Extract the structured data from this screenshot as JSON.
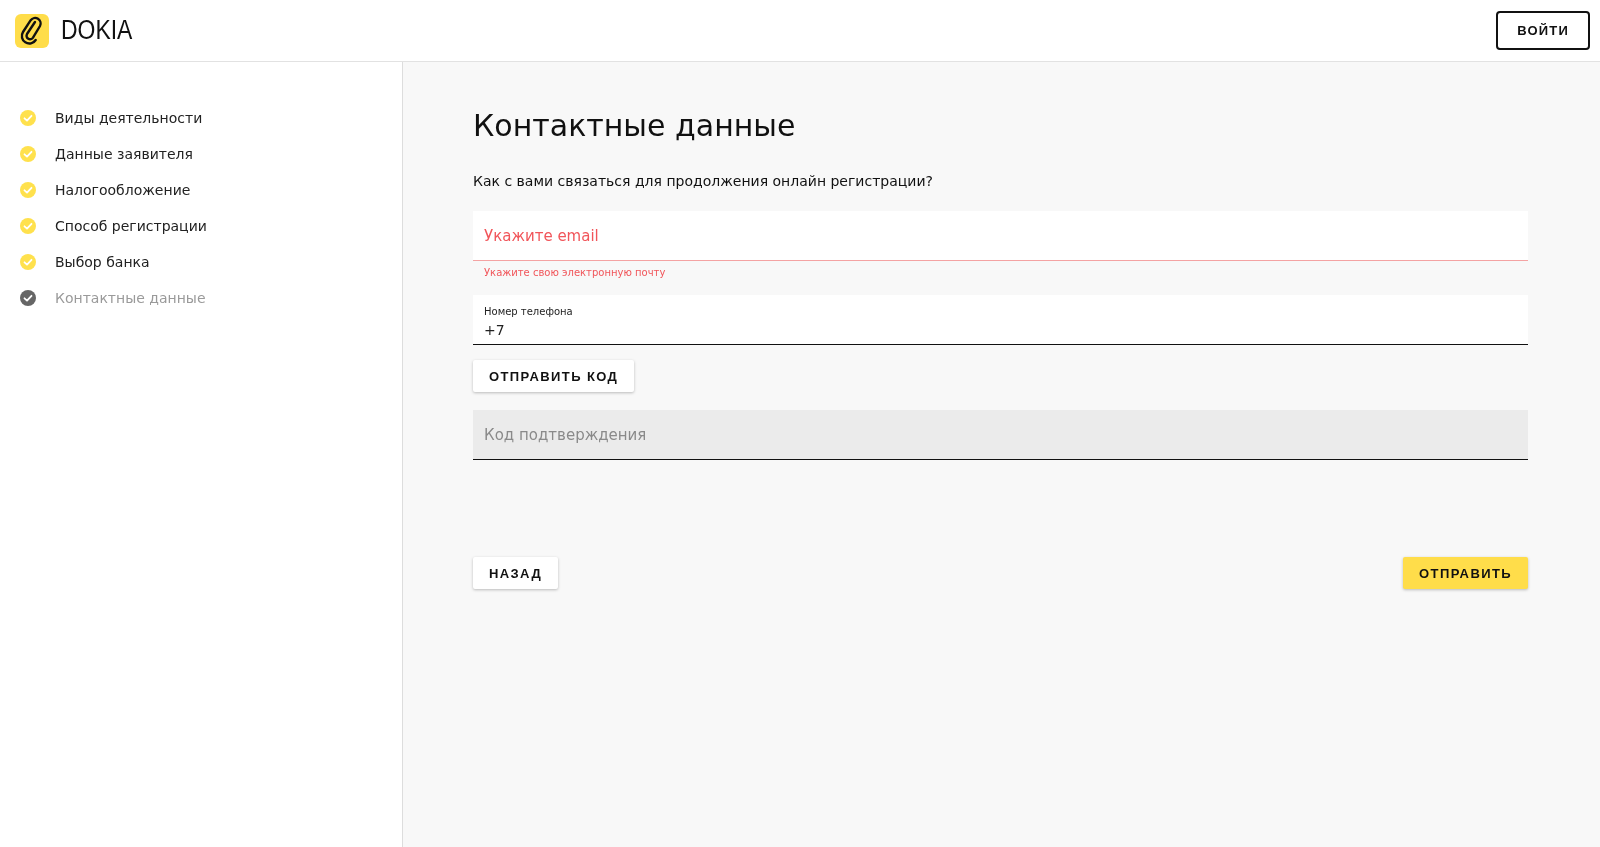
{
  "header": {
    "logo_text": "DOKIA",
    "login_button": "ВОЙТИ"
  },
  "steps": [
    {
      "label": "Виды деятельности",
      "selected": false
    },
    {
      "label": "Данные заявителя",
      "selected": false
    },
    {
      "label": "Налогообложение",
      "selected": false
    },
    {
      "label": "Способ регистрации",
      "selected": false
    },
    {
      "label": "Выбор банка",
      "selected": false
    },
    {
      "label": "Контактные данные",
      "selected": true
    }
  ],
  "form": {
    "title": "Контактные данные",
    "question": "Как с вами связаться для продолжения онлайн регистрации?",
    "email": {
      "placeholder": "Укажите email",
      "error": "Укажите свою электронную почту"
    },
    "phone": {
      "label": "Номер телефона",
      "value": "+7"
    },
    "send_code_button": "ОТПРАВИТЬ КОД",
    "code": {
      "placeholder": "Код подтверждения",
      "disabled": true
    },
    "back_button": "НАЗАД",
    "submit_button": "ОТПРАВИТЬ"
  }
}
